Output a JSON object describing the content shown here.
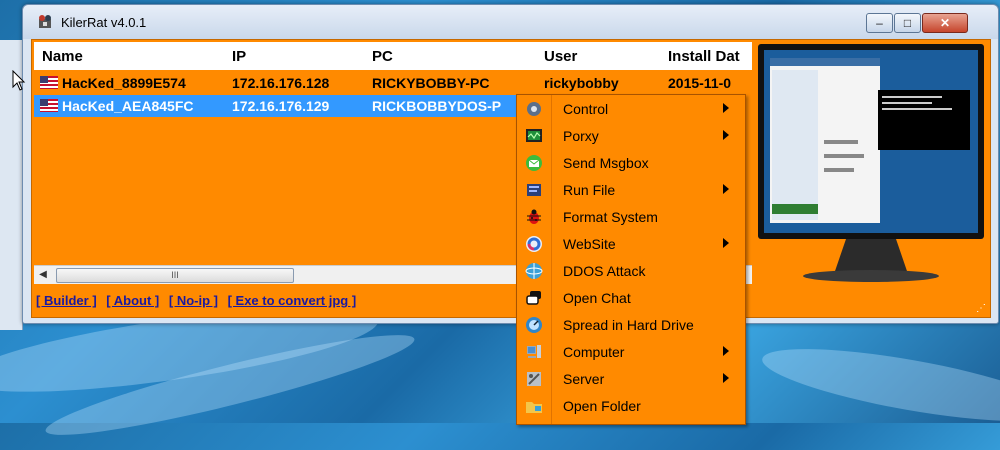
{
  "window": {
    "title": "KilerRat v4.0.1",
    "controls": {
      "minimize": "–",
      "maximize": "□",
      "close": "✕"
    }
  },
  "list": {
    "columns": [
      "Name",
      "IP",
      "PC",
      "User",
      "Install Dat"
    ],
    "rows": [
      {
        "name": "HacKed_8899E574",
        "ip": "172.16.176.128",
        "pc": "RICKYBOBBY-PC",
        "user": "rickybobby",
        "install": "2015-11-0",
        "selected": false
      },
      {
        "name": "HacKed_AEA845FC",
        "ip": "172.16.176.129",
        "pc": "RICKBOBBYDOS-P",
        "user": "",
        "install": "",
        "selected": true
      }
    ],
    "scroll_thumb": "III"
  },
  "links": [
    "[ Builder ]",
    "[ About ]",
    "[ No-ip ]",
    "[ Exe to convert jpg ]"
  ],
  "context_menu": {
    "items": [
      {
        "label": "Control",
        "icon": "gear-icon",
        "submenu": true
      },
      {
        "label": "Porxy",
        "icon": "proxy-monitor-icon",
        "submenu": true
      },
      {
        "label": "Send Msgbox",
        "icon": "message-icon",
        "submenu": false
      },
      {
        "label": "Run File",
        "icon": "run-file-icon",
        "submenu": true
      },
      {
        "label": "Format System",
        "icon": "bug-icon",
        "submenu": false
      },
      {
        "label": "WebSite",
        "icon": "website-icon",
        "submenu": true
      },
      {
        "label": "DDOS Attack",
        "icon": "ddos-icon",
        "submenu": false
      },
      {
        "label": "Open Chat",
        "icon": "chat-icon",
        "submenu": false
      },
      {
        "label": "Spread in Hard Drive",
        "icon": "spread-icon",
        "submenu": false
      },
      {
        "label": "Computer",
        "icon": "computer-icon",
        "submenu": true
      },
      {
        "label": "Server",
        "icon": "server-icon",
        "submenu": true
      },
      {
        "label": "Open Folder",
        "icon": "folder-icon",
        "submenu": false
      }
    ]
  },
  "colors": {
    "accent": "#ff8a00",
    "selection": "#3399ff",
    "link": "#1a1aa0"
  }
}
